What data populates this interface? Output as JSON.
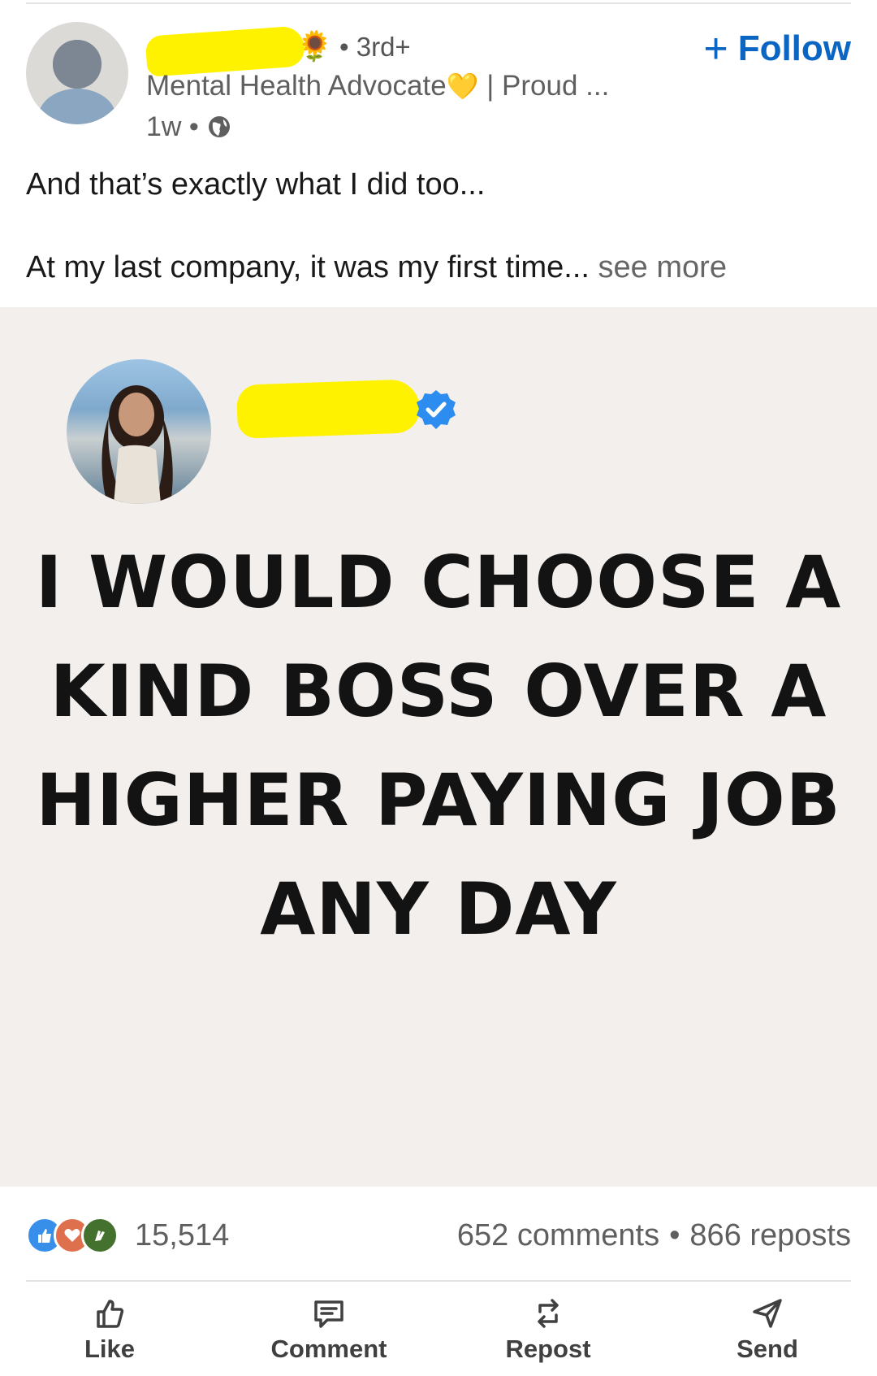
{
  "post": {
    "author": {
      "degree": "• 3rd+",
      "headline_prefix": "Mental Health Advocate",
      "headline_suffix": " | Proud ...",
      "time": "1w •"
    },
    "follow_label": "Follow",
    "text_line1": "And that’s exactly what I did too...",
    "text_line2": "At my last company, it was my first time...",
    "see_more": "see more"
  },
  "media": {
    "quote": "I WOULD CHOOSE A KIND BOSS OVER A HIGHER PAYING JOB ANY DAY"
  },
  "social": {
    "reactions_count": "15,514",
    "comments": "652 comments",
    "separator": "•",
    "reposts": "866 reposts"
  },
  "actions": {
    "like": "Like",
    "comment": "Comment",
    "repost": "Repost",
    "send": "Send"
  },
  "colors": {
    "accent": "#0a66c2",
    "highlight": "#fff200",
    "media_bg": "#f2efec"
  }
}
